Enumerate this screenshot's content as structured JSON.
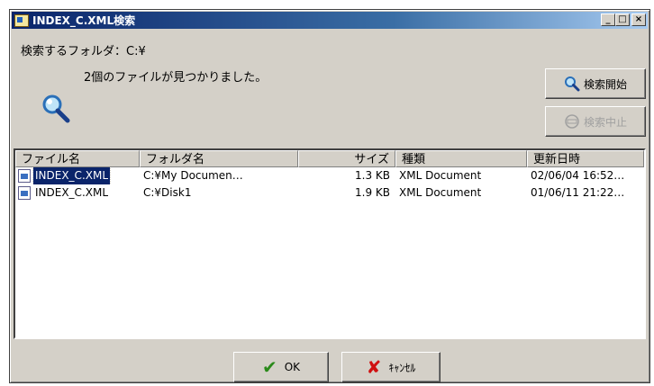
{
  "window": {
    "title": "INDEX_C.XML検索",
    "controls": {
      "minimize": "_",
      "maximize": "□",
      "close": "×"
    }
  },
  "header": {
    "folder_label": "検索するフォルダ：C:¥",
    "found_label": "2個のファイルが見つかりました。",
    "search_start_label": "検索開始",
    "search_stop_label": "検索中止"
  },
  "list": {
    "columns": [
      "ファイル名",
      "フォルダ名",
      "サイズ",
      "種類",
      "更新日時"
    ],
    "rows": [
      {
        "name": "INDEX_C.XML",
        "folder": "C:¥My Documen…",
        "size": "1.3 KB",
        "type": "XML Document",
        "date": "02/06/04 16:52…",
        "selected": true
      },
      {
        "name": "INDEX_C.XML",
        "folder": "C:¥Disk1",
        "size": "1.9 KB",
        "type": "XML Document",
        "date": "01/06/11 21:22…",
        "selected": false
      }
    ]
  },
  "footer": {
    "ok_label": "OK",
    "cancel_label": "ｷｬﾝｾﾙ"
  },
  "colors": {
    "titlebar_start": "#0a246a",
    "titlebar_end": "#a6caf0",
    "window_face": "#d4d0c8",
    "selection": "#0a246a",
    "ok_check": "#2a8a1a",
    "cancel_x": "#d01010"
  },
  "icons": {
    "app": "app-icon",
    "magnifier": "magnifier-icon",
    "search_start": "search-icon",
    "search_stop": "stop-icon",
    "file": "xml-file-icon",
    "ok": "check-icon",
    "cancel": "x-icon"
  }
}
